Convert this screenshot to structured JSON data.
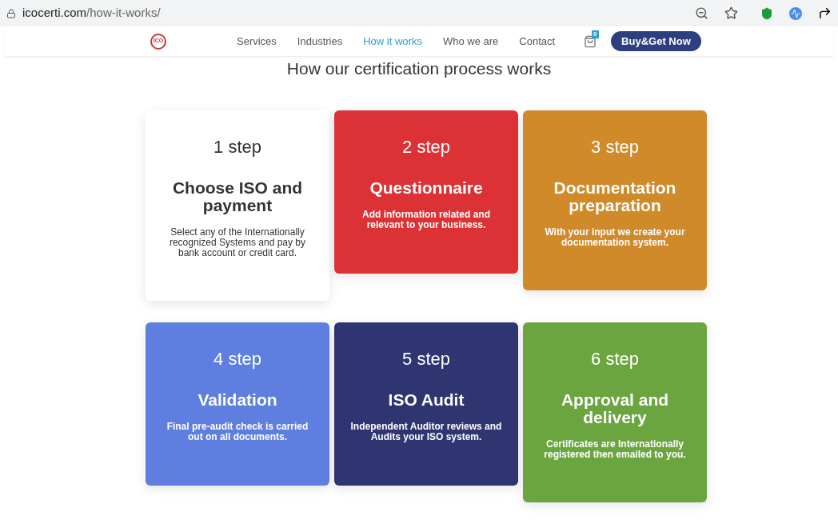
{
  "address_bar": {
    "url_host": "icocerti.com",
    "url_path": "/how-it-works/"
  },
  "nav": {
    "logo": "ICO",
    "items": [
      {
        "label": "Services",
        "selected": false
      },
      {
        "label": "Industries",
        "selected": false
      },
      {
        "label": "How it works",
        "selected": true
      },
      {
        "label": "Who we are",
        "selected": false
      },
      {
        "label": "Contact",
        "selected": false
      }
    ],
    "cart_count": "0",
    "cta": "Buy&Get Now"
  },
  "title": "How our certification process works",
  "steps": [
    {
      "step": "1 step",
      "heading": "Choose ISO and payment",
      "text": "Select any of the Internationally recognized Systems and pay by bank account or credit card.",
      "color": "#ffffff"
    },
    {
      "step": "2 step",
      "heading": "Questionnaire",
      "text": "Add information related and relevant to your business.",
      "color": "#dc3236"
    },
    {
      "step": "3 step",
      "heading": "Documentation preparation",
      "text": "With your input we create your documentation system.",
      "color": "#d08a2a"
    },
    {
      "step": "4 step",
      "heading": "Validation",
      "text": "Final pre-audit check is carried out on all documents.",
      "color": "#5f7fe0"
    },
    {
      "step": "5 step",
      "heading": "ISO Audit",
      "text": "Independent Auditor reviews and Audits your ISO system.",
      "color": "#2e3570"
    },
    {
      "step": "6 step",
      "heading": "Approval and delivery",
      "text": "Certificates are Internationally registered then emailed to you.",
      "color": "#6aa53f"
    }
  ]
}
